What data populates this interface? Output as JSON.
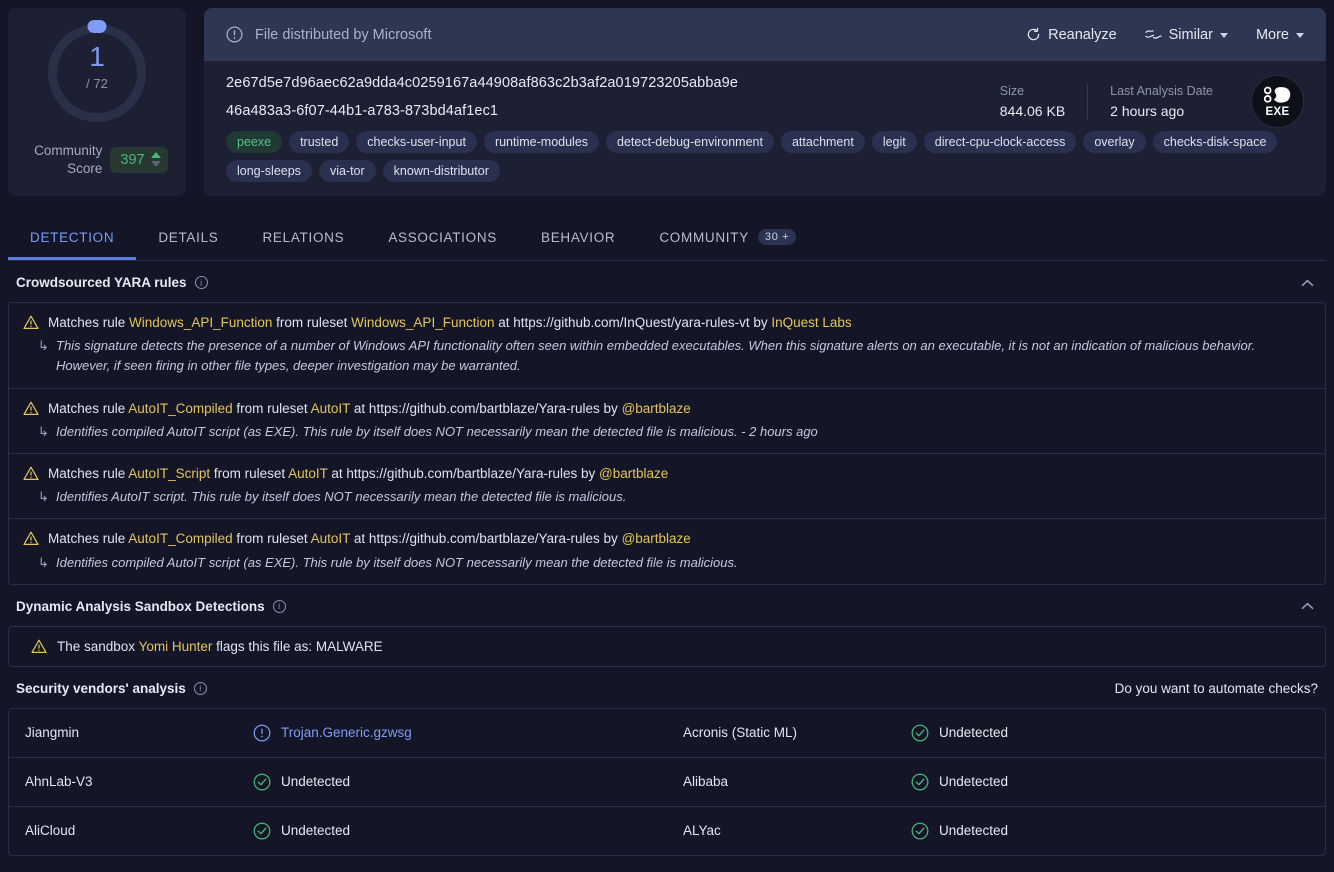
{
  "score": {
    "detections": "1",
    "total": "/ 72",
    "community_score_label": "Community Score",
    "community_score_value": "397"
  },
  "banner": {
    "icon": "exclamation-circle-icon",
    "text": "File distributed by Microsoft",
    "actions": [
      {
        "label": "Reanalyze",
        "icon": "refresh-icon",
        "caret": false
      },
      {
        "label": "Similar",
        "icon": "similar-waves-icon",
        "caret": true
      },
      {
        "label": "More",
        "icon": "",
        "caret": true
      }
    ]
  },
  "file": {
    "sha256": "2e67d5e7d96aec62a9dda4c0259167a44908af863c2b3af2a019723205abba9e",
    "name": "46a483a3-6f07-44b1-a783-873bd4af1ec1",
    "size_label": "Size",
    "size_value": "844.06 KB",
    "last_analysis_label": "Last Analysis Date",
    "last_analysis_value": "2 hours ago",
    "filetype_badge": "EXE",
    "filetype_icon": "exe-gear-icon",
    "tags": [
      {
        "text": "peexe",
        "style": "green"
      },
      {
        "text": "trusted",
        "style": "default"
      },
      {
        "text": "checks-user-input",
        "style": "default"
      },
      {
        "text": "runtime-modules",
        "style": "default"
      },
      {
        "text": "detect-debug-environment",
        "style": "default"
      },
      {
        "text": "attachment",
        "style": "default"
      },
      {
        "text": "legit",
        "style": "default"
      },
      {
        "text": "direct-cpu-clock-access",
        "style": "default"
      },
      {
        "text": "overlay",
        "style": "default"
      },
      {
        "text": "checks-disk-space",
        "style": "default"
      },
      {
        "text": "long-sleeps",
        "style": "default"
      },
      {
        "text": "via-tor",
        "style": "default"
      },
      {
        "text": "known-distributor",
        "style": "default"
      }
    ]
  },
  "tabs": [
    {
      "label": "DETECTION",
      "active": true,
      "badge": ""
    },
    {
      "label": "DETAILS",
      "active": false,
      "badge": ""
    },
    {
      "label": "RELATIONS",
      "active": false,
      "badge": ""
    },
    {
      "label": "ASSOCIATIONS",
      "active": false,
      "badge": ""
    },
    {
      "label": "BEHAVIOR",
      "active": false,
      "badge": ""
    },
    {
      "label": "COMMUNITY",
      "active": false,
      "badge": "30 +"
    }
  ],
  "yara": {
    "title": "Crowdsourced YARA rules",
    "collapse_icon": "chevron-up-icon",
    "rules": [
      {
        "prefix": "Matches rule ",
        "rule": "Windows_API_Function",
        "mid": " from ruleset ",
        "ruleset": "Windows_API_Function",
        "at": " at https://github.com/InQuest/yara-rules-vt by ",
        "author": "InQuest Labs",
        "desc": "This signature detects the presence of a number of Windows API functionality often seen within embedded executables. When this signature alerts on an executable, it is not an indication of malicious behavior. However, if seen firing in other file types, deeper investigation may be warranted."
      },
      {
        "prefix": "Matches rule ",
        "rule": "AutoIT_Compiled",
        "mid": " from ruleset ",
        "ruleset": "AutoIT",
        "at": " at https://github.com/bartblaze/Yara-rules by ",
        "author": "@bartblaze",
        "desc": "Identifies compiled AutoIT script (as EXE). This rule by itself does NOT necessarily mean the detected file is malicious. - 2 hours ago"
      },
      {
        "prefix": "Matches rule ",
        "rule": "AutoIT_Script",
        "mid": " from ruleset ",
        "ruleset": "AutoIT",
        "at": " at https://github.com/bartblaze/Yara-rules by ",
        "author": "@bartblaze",
        "desc": "Identifies AutoIT script. This rule by itself does NOT necessarily mean the detected file is malicious."
      },
      {
        "prefix": "Matches rule ",
        "rule": "AutoIT_Compiled",
        "mid": " from ruleset ",
        "ruleset": "AutoIT",
        "at": " at https://github.com/bartblaze/Yara-rules by ",
        "author": "@bartblaze",
        "desc": "Identifies compiled AutoIT script (as EXE). This rule by itself does NOT necessarily mean the detected file is malicious."
      }
    ]
  },
  "sandbox": {
    "title": "Dynamic Analysis Sandbox Detections",
    "collapse_icon": "chevron-up-icon",
    "prefix": "The sandbox ",
    "name": "Yomi Hunter",
    "suffix": " flags this file as: MALWARE"
  },
  "vendors": {
    "title": "Security vendors' analysis",
    "automate_link": "Do you want to automate checks?",
    "rows": [
      {
        "left": {
          "name": "Jiangmin",
          "result": "Trojan.Generic.gzwsg",
          "status": "malicious"
        },
        "right": {
          "name": "Acronis (Static ML)",
          "result": "Undetected",
          "status": "clean"
        }
      },
      {
        "left": {
          "name": "AhnLab-V3",
          "result": "Undetected",
          "status": "clean"
        },
        "right": {
          "name": "Alibaba",
          "result": "Undetected",
          "status": "clean"
        }
      },
      {
        "left": {
          "name": "AliCloud",
          "result": "Undetected",
          "status": "clean"
        },
        "right": {
          "name": "ALYac",
          "result": "Undetected",
          "status": "clean"
        }
      }
    ]
  },
  "colors": {
    "accent_blue": "#7e9cf5",
    "green": "#45b97c",
    "yellow": "#e3c55a",
    "background": "#141627",
    "card": "#1d2033",
    "banner": "#2e3751"
  }
}
